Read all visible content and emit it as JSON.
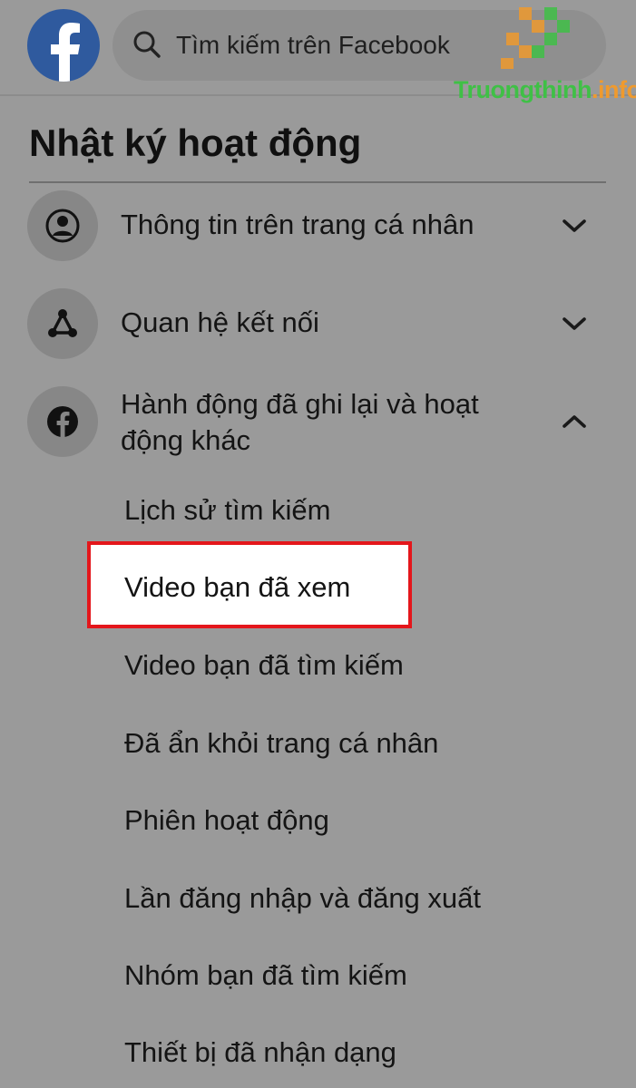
{
  "search": {
    "placeholder": "Tìm kiếm trên Facebook"
  },
  "watermark": {
    "part1": "Truongthinh",
    "part2": ".info"
  },
  "page": {
    "title": "Nhật ký hoạt động"
  },
  "sections": [
    {
      "label": "Thông tin trên trang cá nhân",
      "icon": "profile-icon",
      "state": "collapsed"
    },
    {
      "label": "Quan hệ kết nối",
      "icon": "connections-icon",
      "state": "collapsed"
    },
    {
      "label": "Hành động đã ghi lại và hoạt động khác",
      "icon": "facebook-icon",
      "state": "expanded"
    }
  ],
  "subitems": [
    "Lịch sử tìm kiếm",
    "Video bạn đã xem",
    "Video bạn đã tìm kiếm",
    "Đã ẩn khỏi trang cá nhân",
    "Phiên hoạt động",
    "Lần đăng nhập và đăng xuất",
    "Nhóm bạn đã tìm kiếm",
    "Thiết bị đã nhận dạng"
  ],
  "colors": {
    "background": "#9a9a9a",
    "highlight_border": "#e4161b",
    "facebook_blue": "#2f5a9e"
  }
}
